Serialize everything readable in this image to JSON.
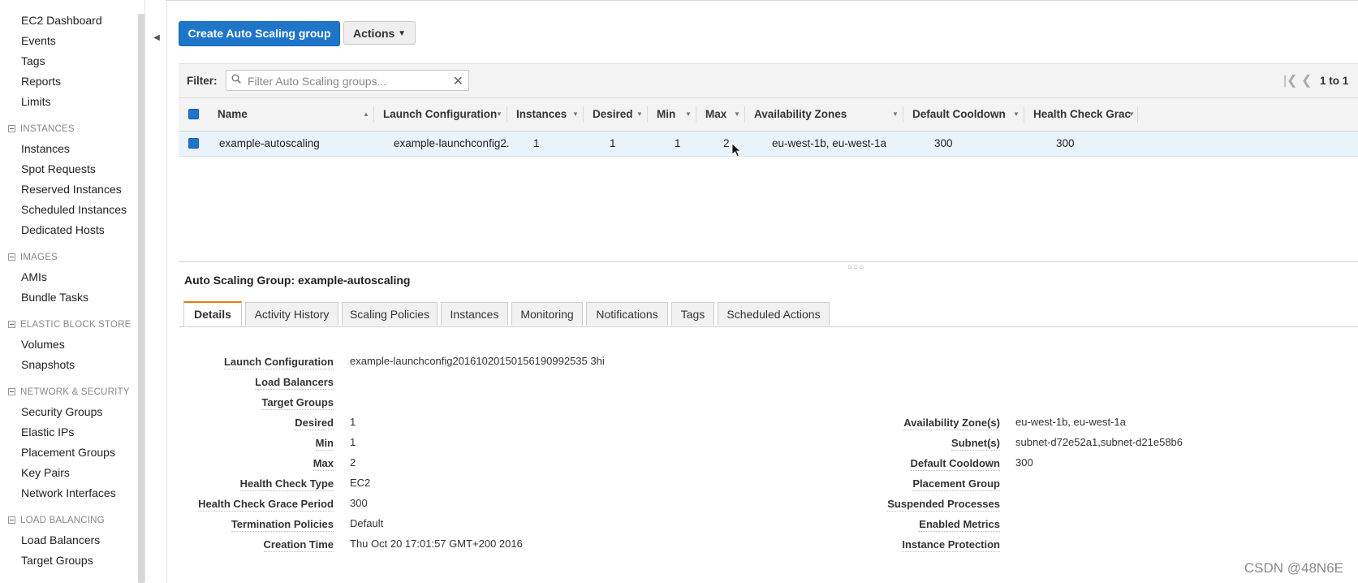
{
  "sidebar": {
    "top_items": [
      "EC2 Dashboard",
      "Events",
      "Tags",
      "Reports",
      "Limits"
    ],
    "sections": [
      {
        "title": "INSTANCES",
        "items": [
          "Instances",
          "Spot Requests",
          "Reserved Instances",
          "Scheduled Instances",
          "Dedicated Hosts"
        ]
      },
      {
        "title": "IMAGES",
        "items": [
          "AMIs",
          "Bundle Tasks"
        ]
      },
      {
        "title": "ELASTIC BLOCK STORE",
        "items": [
          "Volumes",
          "Snapshots"
        ]
      },
      {
        "title": "NETWORK & SECURITY",
        "items": [
          "Security Groups",
          "Elastic IPs",
          "Placement Groups",
          "Key Pairs",
          "Network Interfaces"
        ]
      },
      {
        "title": "LOAD BALANCING",
        "items": [
          "Load Balancers",
          "Target Groups"
        ]
      }
    ]
  },
  "toolbar": {
    "create_label": "Create Auto Scaling group",
    "actions_label": "Actions"
  },
  "filter": {
    "label": "Filter:",
    "placeholder": "Filter Auto Scaling groups...",
    "value": ""
  },
  "pager": {
    "range": "1 to 1"
  },
  "grid": {
    "columns": [
      "Name",
      "Launch Configuration",
      "Instances",
      "Desired",
      "Min",
      "Max",
      "Availability Zones",
      "Default Cooldown",
      "Health Check Grac"
    ],
    "rows": [
      [
        "example-autoscaling",
        "example-launchconfig2...",
        "1",
        "1",
        "1",
        "2",
        "eu-west-1b, eu-west-1a",
        "300",
        "300"
      ]
    ]
  },
  "detail": {
    "title": "Auto Scaling Group: example-autoscaling",
    "tabs": [
      "Details",
      "Activity History",
      "Scaling Policies",
      "Instances",
      "Monitoring",
      "Notifications",
      "Tags",
      "Scheduled Actions"
    ],
    "left": [
      {
        "label": "Launch Configuration",
        "value": "example-launchconfig20161020150156190992535 3hi"
      },
      {
        "label": "Load Balancers",
        "value": ""
      },
      {
        "label": "Target Groups",
        "value": ""
      },
      {
        "label": "Desired",
        "value": "1"
      },
      {
        "label": "Min",
        "value": "1"
      },
      {
        "label": "Max",
        "value": "2"
      },
      {
        "label": "Health Check Type",
        "value": "EC2"
      },
      {
        "label": "Health Check Grace Period",
        "value": "300"
      },
      {
        "label": "Termination Policies",
        "value": "Default"
      },
      {
        "label": "Creation Time",
        "value": "Thu Oct 20 17:01:57 GMT+200 2016"
      }
    ],
    "right": [
      {
        "label": "Availability Zone(s)",
        "value": "eu-west-1b, eu-west-1a"
      },
      {
        "label": "Subnet(s)",
        "value": "subnet-d72e52a1,subnet-d21e58b6"
      },
      {
        "label": "Default Cooldown",
        "value": "300"
      },
      {
        "label": "Placement Group",
        "value": ""
      },
      {
        "label": "Suspended Processes",
        "value": ""
      },
      {
        "label": "Enabled Metrics",
        "value": ""
      },
      {
        "label": "Instance Protection",
        "value": ""
      }
    ]
  },
  "watermark": "CSDN @48N6E",
  "colors": {
    "primary": "#1f76c9",
    "tab_accent": "#e47911",
    "selected_row": "#e9f3fb"
  }
}
